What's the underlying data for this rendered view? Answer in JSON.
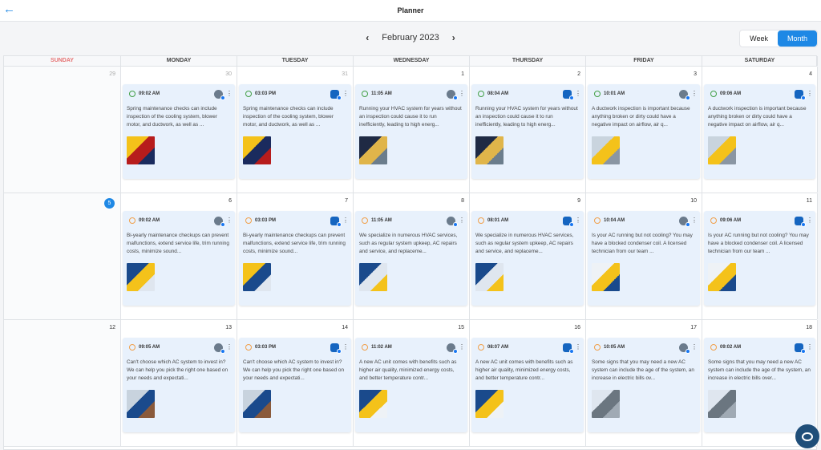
{
  "header": {
    "title": "Planner",
    "back_icon": "arrow-left-icon"
  },
  "nav": {
    "month": "February 2023",
    "prev_icon": "chevron-left-icon",
    "next_icon": "chevron-right-icon"
  },
  "view_toggle": {
    "week": "Week",
    "month": "Month",
    "active": "Month"
  },
  "days": [
    "SUNDAY",
    "MONDAY",
    "TUESDAY",
    "WEDNESDAY",
    "THURSDAY",
    "FRIDAY",
    "SATURDAY"
  ],
  "weeks": [
    {
      "dates": [
        "29",
        "30",
        "31",
        "1",
        "2",
        "3",
        "4"
      ],
      "posts": [
        null,
        {
          "time": "09:02 AM",
          "text": "Spring maintenance checks can include inspection of the cooling system, blower motor, and ductwork, as well as ...",
          "clock": "green",
          "account": "photo",
          "thumb": [
            "#f4c21a",
            "#b71c1c",
            "#1a2b5e"
          ]
        },
        {
          "time": "03:03 PM",
          "text": "Spring maintenance checks can include inspection of the cooling system, blower motor, and ductwork, as well as ...",
          "clock": "green",
          "account": "logo",
          "thumb": [
            "#f4c21a",
            "#1a2b5e",
            "#b71c1c"
          ]
        },
        {
          "time": "11:05 AM",
          "text": "Running your HVAC system for years without an inspection could cause it to run inefficiently, leading to high energ...",
          "clock": "green",
          "account": "photo",
          "thumb": [
            "#1f2a44",
            "#e0b54a",
            "#6b7d8c"
          ]
        },
        {
          "time": "08:04 AM",
          "text": "Running your HVAC system for years without an inspection could cause it to run inefficiently, leading to high energ...",
          "clock": "green",
          "account": "logo",
          "thumb": [
            "#1f2a44",
            "#e0b54a",
            "#6b7d8c"
          ]
        },
        {
          "time": "10:01 AM",
          "text": "A ductwork inspection is important because anything broken or dirty could have a negative impact on airflow, air q...",
          "clock": "green",
          "account": "photo",
          "thumb": [
            "#c9d4de",
            "#f4c21a",
            "#8a96a3"
          ]
        },
        {
          "time": "09:06 AM",
          "text": "A ductwork inspection is important because anything broken or dirty could have a negative impact on airflow, air q...",
          "clock": "green",
          "account": "logo",
          "thumb": [
            "#c9d4de",
            "#f4c21a",
            "#8a96a3"
          ]
        }
      ]
    },
    {
      "dates": [
        "5",
        "6",
        "7",
        "8",
        "9",
        "10",
        "11"
      ],
      "posts": [
        null,
        {
          "time": "09:02 AM",
          "text": "Bi-yearly maintenance checkups can prevent malfunctions, extend service life, trim running costs, minimize sound...",
          "clock": "orange",
          "account": "photo",
          "thumb": [
            "#1a4a8c",
            "#f4c21a",
            "#dfe6ef"
          ]
        },
        {
          "time": "03:03 PM",
          "text": "Bi-yearly maintenance checkups can prevent malfunctions, extend service life, trim running costs, minimize sound...",
          "clock": "orange",
          "account": "logo",
          "thumb": [
            "#f4c21a",
            "#1a4a8c",
            "#dfe6ef"
          ]
        },
        {
          "time": "11:05 AM",
          "text": "We specialize in numerous HVAC services, such as regular system upkeep, AC repairs and service, and replaceme...",
          "clock": "orange",
          "account": "photo",
          "thumb": [
            "#1a4a8c",
            "#dfe6ef",
            "#f4c21a"
          ]
        },
        {
          "time": "08:01 AM",
          "text": "We specialize in numerous HVAC services, such as regular system upkeep, AC repairs and service, and replaceme...",
          "clock": "orange",
          "account": "logo",
          "thumb": [
            "#1a4a8c",
            "#dfe6ef",
            "#f4c21a"
          ]
        },
        {
          "time": "10:04 AM",
          "text": "Is your AC running but not cooling? You may have a blocked condenser coil. A licensed technician from our team ...",
          "clock": "orange",
          "account": "photo",
          "thumb": [
            "#eef2f6",
            "#f4c21a",
            "#1a4a8c"
          ]
        },
        {
          "time": "09:06 AM",
          "text": "Is your AC running but not cooling? You may have a blocked condenser coil. A licensed technician from our team ...",
          "clock": "orange",
          "account": "logo",
          "thumb": [
            "#eef2f6",
            "#f4c21a",
            "#1a4a8c"
          ]
        }
      ]
    },
    {
      "dates": [
        "12",
        "13",
        "14",
        "15",
        "16",
        "17",
        "18"
      ],
      "posts": [
        null,
        {
          "time": "09:05 AM",
          "text": "Can't choose which AC system to invest in? We can help you pick the right one based on your needs and expectati...",
          "clock": "orange",
          "account": "photo",
          "thumb": [
            "#c8d3de",
            "#1a4a8c",
            "#8a5a3b"
          ]
        },
        {
          "time": "03:03 PM",
          "text": "Can't choose which AC system to invest in? We can help you pick the right one based on your needs and expectati...",
          "clock": "orange",
          "account": "logo",
          "thumb": [
            "#c8d3de",
            "#1a4a8c",
            "#8a5a3b"
          ]
        },
        {
          "time": "11:02 AM",
          "text": "A new AC unit comes with benefits such as higher air quality, minimized energy costs, and better temperature contr...",
          "clock": "orange",
          "account": "photo",
          "thumb": [
            "#1a4a8c",
            "#f4c21a",
            "#eef2f6"
          ]
        },
        {
          "time": "08:07 AM",
          "text": "A new AC unit comes with benefits such as higher air quality, minimized energy costs, and better temperature contr...",
          "clock": "orange",
          "account": "logo",
          "thumb": [
            "#1a4a8c",
            "#f4c21a",
            "#eef2f6"
          ]
        },
        {
          "time": "10:05 AM",
          "text": "Some signs that you may need a new AC system can include the age of the system, an increase in electric bills ov...",
          "clock": "orange",
          "account": "photo",
          "thumb": [
            "#dfe6ef",
            "#6b7680",
            "#a0aab4"
          ]
        },
        {
          "time": "09:02 AM",
          "text": "Some signs that you may need a new AC system can include the age of the system, an increase in electric bills over...",
          "clock": "orange",
          "account": "logo",
          "thumb": [
            "#dfe6ef",
            "#6b7680",
            "#a0aab4"
          ]
        }
      ]
    }
  ],
  "today": "5",
  "muted_dates": [
    "29",
    "30",
    "31"
  ],
  "colors": {
    "accent": "#1e88e5",
    "sunday": "#e57373",
    "card_bg": "#e8f1fc",
    "clock_green": "#43a047",
    "clock_orange": "#f0a04b"
  },
  "chat_icon": "chat-bubble-icon"
}
